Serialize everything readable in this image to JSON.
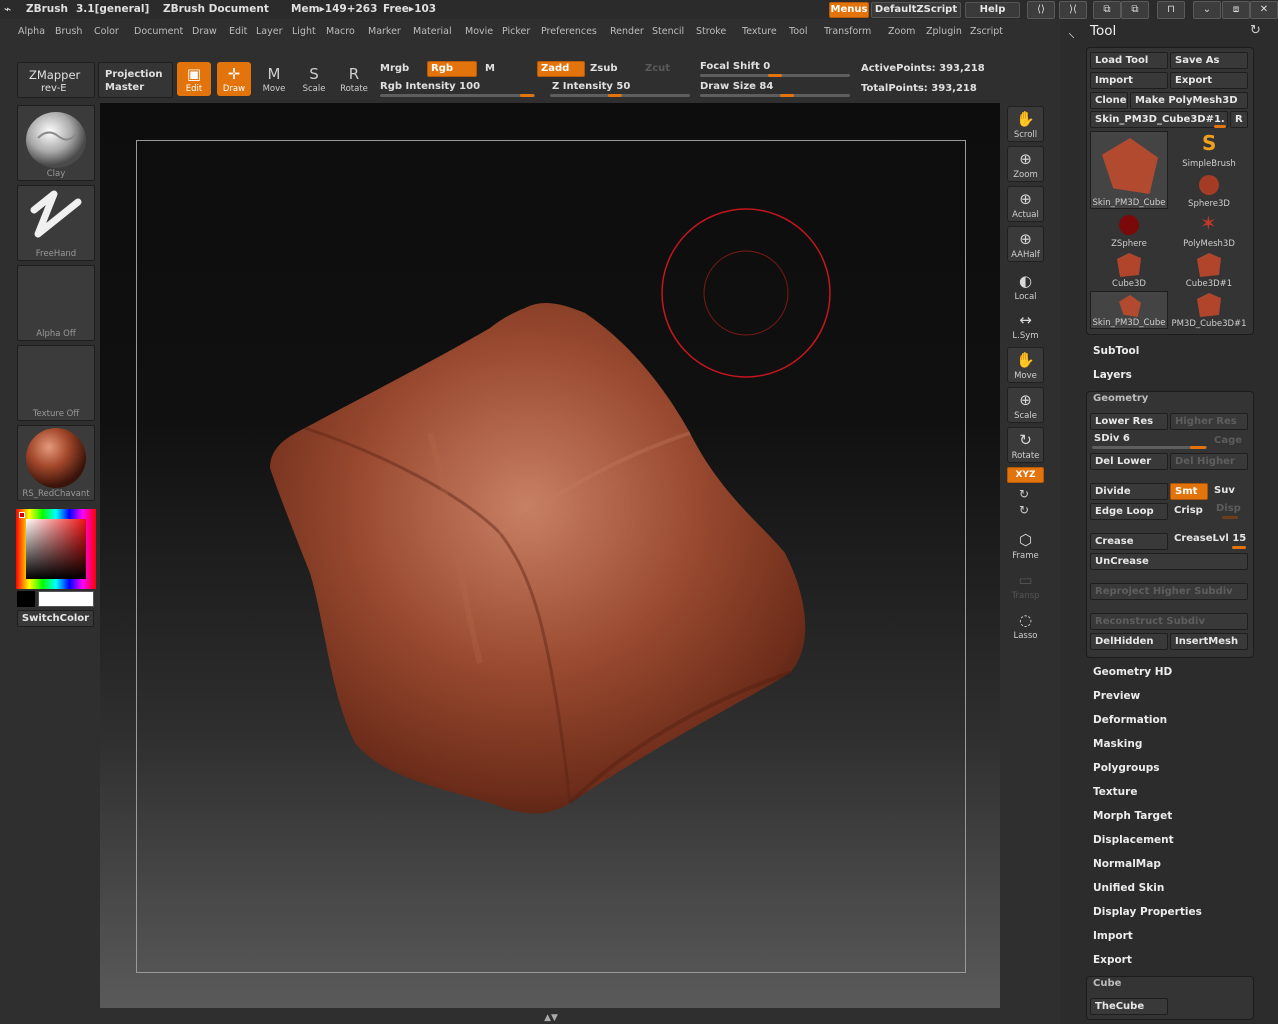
{
  "titlebar": {
    "app": "ZBrush",
    "version": "3.1[general]",
    "document": "ZBrush Document",
    "mem": "Mem▸149+263",
    "free": "Free▸103",
    "menus_btn": "Menus",
    "script_btn": "DefaultZScript",
    "help_btn": "Help"
  },
  "menubar": [
    "Alpha",
    "Brush",
    "Color",
    "Document",
    "Draw",
    "Edit",
    "Layer",
    "Light",
    "Macro",
    "Marker",
    "Material",
    "Movie",
    "Picker",
    "Preferences",
    "Render",
    "Stencil",
    "Stroke",
    "Texture",
    "Tool",
    "Transform",
    "Zoom",
    "Zplugin",
    "Zscript"
  ],
  "shelf": {
    "zmapper": "ZMapper",
    "zmapper_sub": "rev-E",
    "projection": "Projection",
    "projection_sub": "Master",
    "tools": [
      {
        "label": "Edit",
        "glyph": "▣"
      },
      {
        "label": "Draw",
        "glyph": "✛"
      },
      {
        "label": "Move",
        "glyph": "M"
      },
      {
        "label": "Scale",
        "glyph": "S"
      },
      {
        "label": "Rotate",
        "glyph": "R"
      }
    ],
    "mrgb": "Mrgb",
    "rgb": "Rgb",
    "m": "M",
    "rgb_intensity": "Rgb Intensity 100",
    "zadd": "Zadd",
    "zsub": "Zsub",
    "zcut": "Zcut",
    "z_intensity": "Z Intensity 50",
    "focal_shift": "Focal Shift 0",
    "draw_size": "Draw Size 84",
    "active_points": "ActivePoints: 393,218",
    "total_points": "TotalPoints: 393,218"
  },
  "left_tray": {
    "brush": "Clay",
    "stroke": "FreeHand",
    "alpha": "Alpha  Off",
    "texture": "Texture  Off",
    "material": "RS_RedChavant",
    "switch_color": "SwitchColor"
  },
  "right_shelf": [
    "Scroll",
    "Zoom",
    "Actual",
    "AAHalf",
    "Local",
    "L.Sym",
    "Move",
    "Scale",
    "Rotate",
    "Frame",
    "Transp",
    "Lasso"
  ],
  "right_shelf_xyz": "XYZ",
  "tool_panel": {
    "title": "Tool",
    "load_tool": "Load Tool",
    "save_as": "Save As",
    "import": "Import",
    "export": "Export",
    "clone": "Clone",
    "make_polymesh": "Make PolyMesh3D",
    "current_tool": "Skin_PM3D_Cube3D#1.",
    "r": "R",
    "thumbs": [
      "Skin_PM3D_Cube",
      "SimpleBrush",
      "Sphere3D",
      "ZSphere",
      "PolyMesh3D",
      "Cube3D",
      "Cube3D#1",
      "Skin_PM3D_Cube",
      "PM3D_Cube3D#1"
    ],
    "subtool": "SubTool",
    "layers": "Layers",
    "geometry": "Geometry",
    "lower_res": "Lower Res",
    "higher_res": "Higher Res",
    "sdiv": "SDiv 6",
    "cage": "Cage",
    "del_lower": "Del Lower",
    "del_higher": "Del Higher",
    "divide": "Divide",
    "smt": "Smt",
    "suv": "Suv",
    "edge_loop": "Edge Loop",
    "crisp": "Crisp",
    "disp": "Disp",
    "crease": "Crease",
    "crease_lvl": "CreaseLvl 15",
    "uncrease": "UnCrease",
    "reproject": "Reproject Higher Subdiv",
    "reconstruct": "Reconstruct Subdiv",
    "delhidden": "DelHidden",
    "insertmesh": "InsertMesh",
    "sections": [
      "Geometry HD",
      "Preview",
      "Deformation",
      "Masking",
      "Polygroups",
      "Texture",
      "Morph Target",
      "Displacement",
      "NormalMap",
      "Unified Skin",
      "Display Properties",
      "Import",
      "Export"
    ],
    "cube": "Cube",
    "thecube": "TheCube"
  },
  "colors": {
    "accent": "#e2740b",
    "model": "#8a3b22",
    "cursor": "#c4161c"
  }
}
